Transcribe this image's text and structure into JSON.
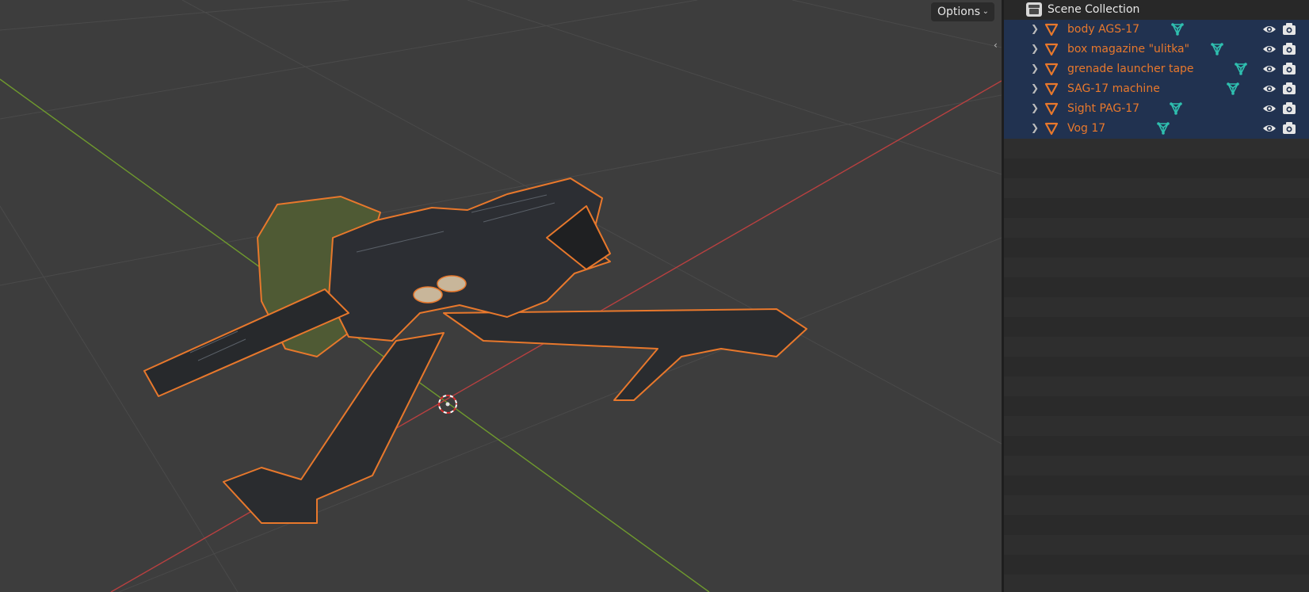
{
  "viewport": {
    "options_label": "Options",
    "options_icon": "chevron-down-icon",
    "collapse_icon": "chevron-left-icon",
    "colors": {
      "background": "#3d3d3d",
      "x_axis": "#c04040",
      "y_axis": "#7aa030",
      "selection_outline": "#e8782c"
    },
    "selected_object": "grenade launcher on tripod (orange selection outline)",
    "cursor_icon": "3d-cursor-icon"
  },
  "outliner": {
    "scene_collection": {
      "label": "Scene Collection",
      "icon": "collection-icon"
    },
    "objects": [
      {
        "name": "body AGS-17",
        "icon": "mesh-object-icon",
        "data_icon": "mesh-data-icon"
      },
      {
        "name": "box magazine \"ulitka\"",
        "icon": "mesh-object-icon",
        "data_icon": "mesh-data-icon"
      },
      {
        "name": "grenade launcher tape",
        "icon": "mesh-object-icon",
        "data_icon": "mesh-data-icon"
      },
      {
        "name": "SAG-17 machine",
        "icon": "mesh-object-icon",
        "data_icon": "mesh-data-icon"
      },
      {
        "name": "Sight PAG-17",
        "icon": "mesh-object-icon",
        "data_icon": "mesh-data-icon"
      },
      {
        "name": "Vog 17",
        "icon": "mesh-object-icon",
        "data_icon": "mesh-data-icon"
      }
    ],
    "colors": {
      "selected_row": "#213250",
      "selected_text": "#e8782c",
      "mesh_icon": "#2fc0b0"
    }
  }
}
